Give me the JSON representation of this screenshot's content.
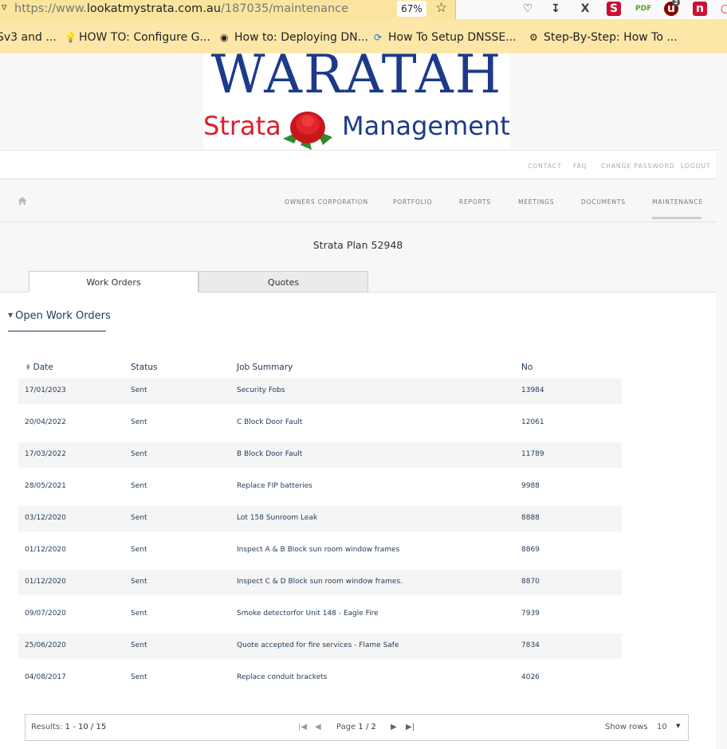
{
  "browser": {
    "url_prefix": "https://www.",
    "url_domain": "lookatmystrata.com.au",
    "url_path": "/187035/maintenance",
    "zoom": "67%",
    "bookmarks": [
      {
        "label": "Sv3 and ..."
      },
      {
        "label": "HOW TO: Configure G..."
      },
      {
        "label": "How to: Deploying DN..."
      },
      {
        "label": "How To Setup DNSSE..."
      },
      {
        "label": "Step-By-Step: How To ..."
      }
    ],
    "ext_badge": "2"
  },
  "logo": {
    "top": "WARATAH",
    "left": "Strata",
    "right": "Management"
  },
  "util_nav": [
    "CONTACT",
    "FAQ",
    "CHANGE PASSWORD",
    "LOGOUT"
  ],
  "main_nav": [
    "OWNERS CORPORATION",
    "PORTFOLIO",
    "REPORTS",
    "MEETINGS",
    "DOCUMENTS",
    "MAINTENANCE"
  ],
  "plan_title": "Strata Plan 52948",
  "tabs": [
    "Work Orders",
    "Quotes"
  ],
  "section_title": "Open Work Orders",
  "table": {
    "headers": [
      "Date",
      "Status",
      "Job Summary",
      "No"
    ],
    "rows": [
      [
        "17/01/2023",
        "Sent",
        "Security Fobs",
        "13984"
      ],
      [
        "20/04/2022",
        "Sent",
        "C Block Door Fault",
        "12061"
      ],
      [
        "17/03/2022",
        "Sent",
        "B Block Door Fault",
        "11789"
      ],
      [
        "28/05/2021",
        "Sent",
        "Replace FIP batteries",
        "9988"
      ],
      [
        "03/12/2020",
        "Sent",
        "Lot 158 Sunroom Leak",
        "8888"
      ],
      [
        "01/12/2020",
        "Sent",
        "Inspect A & B Block sun room window frames",
        "8869"
      ],
      [
        "01/12/2020",
        "Sent",
        "Inspect C & D Block sun room window frames.",
        "8870"
      ],
      [
        "09/07/2020",
        "Sent",
        "Smoke detectorfor Unit 148 - Eagle Fire",
        "7939"
      ],
      [
        "25/06/2020",
        "Sent",
        "Quote accepted for fire services - Flame Safe",
        "7834"
      ],
      [
        "04/08/2017",
        "Sent",
        "Replace conduit brackets",
        "4026"
      ]
    ]
  },
  "pager": {
    "results_label": "Results:",
    "results_value": "1 - 10 / 15",
    "page_label": "Page",
    "page_value": "1 / 2",
    "show_rows_label": "Show rows",
    "show_rows_value": "10"
  }
}
